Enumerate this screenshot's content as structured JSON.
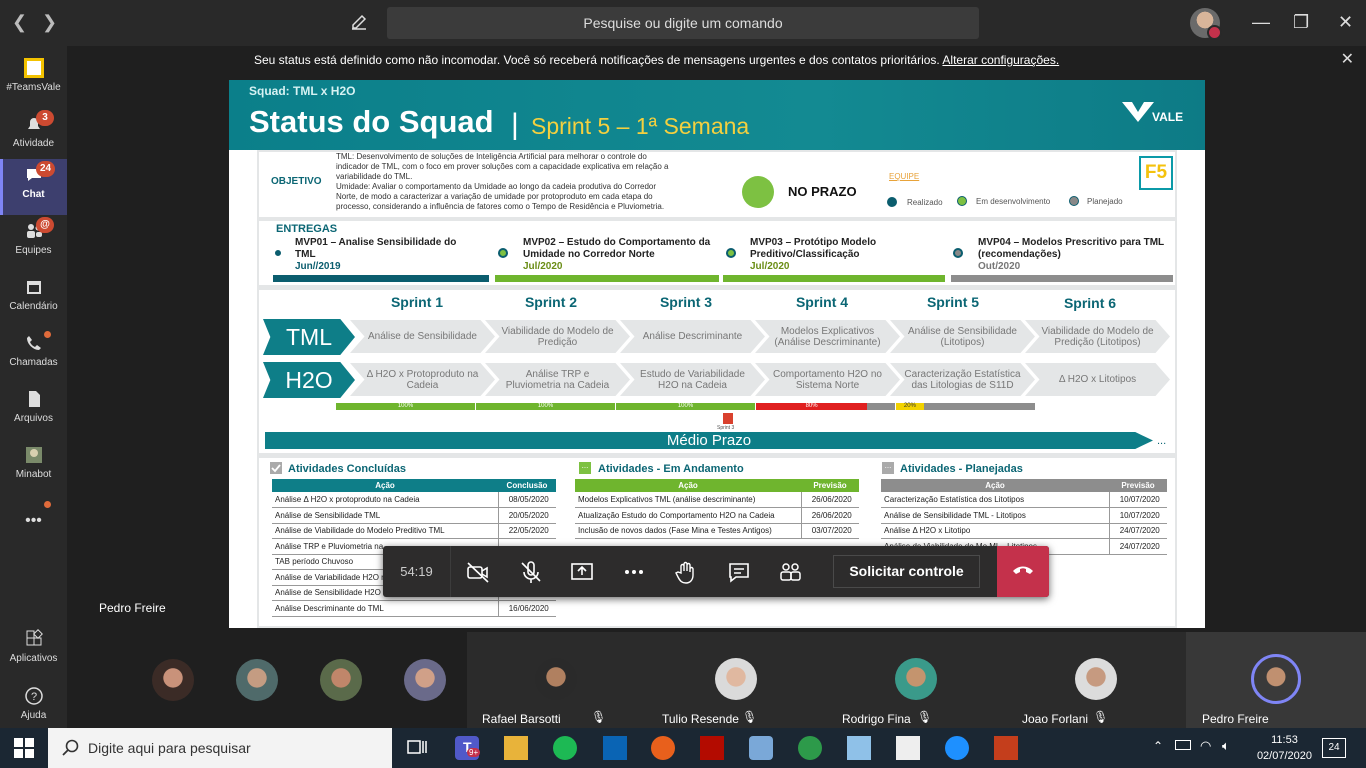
{
  "titlebar": {
    "back_icon": "chevron-left",
    "forward_icon": "chevron-right",
    "search_placeholder": "Pesquise ou digite um comando",
    "window_controls": [
      "—",
      "❐",
      "✕"
    ]
  },
  "notice": {
    "text": "Seu status está definido como não incomodar. Você só receberá notificações de mensagens urgentes e dos contatos prioritários.",
    "link": "Alterar configurações."
  },
  "rail": {
    "items": [
      {
        "label": "#TeamsVale",
        "icon": "team-logo-icon"
      },
      {
        "label": "Atividade",
        "icon": "bell-icon",
        "badge": "3"
      },
      {
        "label": "Chat",
        "icon": "chat-icon",
        "badge": "24"
      },
      {
        "label": "Equipes",
        "icon": "teams-icon",
        "badge": "@"
      },
      {
        "label": "Calendário",
        "icon": "calendar-icon"
      },
      {
        "label": "Chamadas",
        "icon": "phone-icon"
      },
      {
        "label": "Arquivos",
        "icon": "file-icon"
      },
      {
        "label": "Minabot",
        "icon": "bot-icon"
      },
      {
        "label": "•••",
        "icon": "more-icon"
      }
    ],
    "bottom": [
      {
        "label": "Aplicativos",
        "icon": "apps-icon"
      },
      {
        "label": "Ajuda",
        "icon": "help-icon"
      }
    ]
  },
  "slide": {
    "squad": "Squad: TML x H2O",
    "title": "Status do Squad",
    "separator": "|",
    "sprint": "Sprint 5 – 1ª Semana",
    "logo_text": "VALE",
    "objetivo_label": "OBJETIVO",
    "objetivo_text": [
      "TML: Desenvolvimento de soluções de Inteligência Artificial para melhorar o controle do",
      "indicador de TML, com o foco em prover soluções com a capacidade explicativa em relação a",
      "variabilidade do TML.",
      "Umidade: Avaliar o comportamento da Umidade ao longo da cadeia produtiva do Corredor",
      "Norte, de modo a caracterizar a variação de umidade por protoproduto em cada etapa do",
      "processo, considerando a influência de fatores como o Tempo de Residência e Pluviometria."
    ],
    "status_label": "NO PRAZO",
    "equipe_label": "EQUIPE",
    "legend": [
      "Realizado",
      "Em desenvolvimento",
      "Planejado"
    ],
    "f5_logo": "F5",
    "entregas_label": "ENTREGAS",
    "mvps": [
      {
        "title": "MVP01 – Analise Sensibilidade do TML",
        "date": "Jun//2019"
      },
      {
        "title": "MVP02 – Estudo do Comportamento da Umidade no Corredor Norte",
        "date": "Jul/2020"
      },
      {
        "title": "MVP03 – Protótipo Modelo Preditivo/Classificação",
        "date": "Jul/2020"
      },
      {
        "title": "MVP04 – Modelos Prescritivo para TML (recomendações)",
        "date": "Out/2020"
      }
    ],
    "sprints": [
      "Sprint 1",
      "Sprint 2",
      "Sprint 3",
      "Sprint 4",
      "Sprint 5",
      "Sprint 6"
    ],
    "tml_label": "TML",
    "h2o_label": "H2O",
    "tml_steps": [
      "Análise de Sensibilidade",
      "Viabilidade do Modelo de Predição",
      "Análise Descriminante",
      "Modelos Explicativos (Análise Descriminante)",
      "Análise de Sensibilidade (Litotipos)",
      "Viabilidade do Modelo de Predição (Litotipos)"
    ],
    "h2o_steps": [
      "Δ H2O x Protoproduto na Cadeia",
      "Análise TRP e Pluviometria na Cadeia",
      "Estudo de Variabilidade H2O na Cadeia",
      "Comportamento H2O no Sistema Norte",
      "Caracterização Estatística das Litologias de S11D",
      "Δ H2O x Litotipos"
    ],
    "progress": [
      "100%",
      "100%",
      "100%",
      "80%",
      "20%"
    ],
    "progress_values": [
      100,
      100,
      100,
      80,
      20
    ],
    "sprint_marker": "Sprint 3",
    "medio_prazo": "Médio Prazo",
    "medio_more": "...",
    "concluidas": {
      "title": "Atividades Concluídas",
      "headers": [
        "Ação",
        "Conclusão"
      ],
      "rows": [
        [
          "Análise Δ H2O x protoproduto na Cadeia",
          "08/05/2020"
        ],
        [
          "Análise de Sensibilidade TML",
          "20/05/2020"
        ],
        [
          "Análise de Viabilidade do Modelo Preditivo TML",
          "22/05/2020"
        ],
        [
          "Análise TRP e Pluviometria na",
          ""
        ],
        [
          "TAB período Chuvoso",
          ""
        ],
        [
          "Análise de Variabilidade H2O n",
          ""
        ],
        [
          "Análise de Sensibilidade H2O na Cadeia",
          "10/06/2020"
        ],
        [
          "Análise Descriminante do TML",
          "16/06/2020"
        ]
      ]
    },
    "andamento": {
      "title": "Atividades - Em Andamento",
      "headers": [
        "Ação",
        "Previsão"
      ],
      "rows": [
        [
          "Modelos Explicativos TML (análise descriminante)",
          "26/06/2020"
        ],
        [
          "Atualização Estudo do Comportamento H2O na Cadeia",
          "26/06/2020"
        ],
        [
          "Inclusão de novos dados (Fase Mina e Testes Antigos)",
          "03/07/2020"
        ]
      ]
    },
    "planejadas": {
      "title": "Atividades - Planejadas",
      "headers": [
        "Ação",
        "Previsão"
      ],
      "rows": [
        [
          "Caracterização Estatística dos Litotipos",
          "10/07/2020"
        ],
        [
          "Análise de Sensibilidade TML - Litotipos",
          "10/07/2020"
        ],
        [
          "Análise Δ H2O x Litotipo",
          "24/07/2020"
        ],
        [
          "Análise de Viabilidade do Mo ML - Litotipos",
          "24/07/2020"
        ]
      ]
    }
  },
  "call": {
    "timer": "54:19",
    "solicitar": "Solicitar controle",
    "presenter": "Pedro Freire",
    "controls": [
      "camera-off-icon",
      "mic-off-icon",
      "share-icon",
      "more-icon",
      "raise-hand-icon",
      "chat-icon",
      "participants-icon"
    ]
  },
  "participants": [
    {
      "name": "Rafael Barsotti"
    },
    {
      "name": "Tulio Resende"
    },
    {
      "name": "Rodrigo Fina"
    },
    {
      "name": "Joao Forlani"
    },
    {
      "name": "Pedro Freire"
    }
  ],
  "taskbar": {
    "search_placeholder": "Digite aqui para pesquisar",
    "time": "11:53",
    "date": "02/07/2020",
    "notifications": "24",
    "teams_badge": "9+"
  }
}
